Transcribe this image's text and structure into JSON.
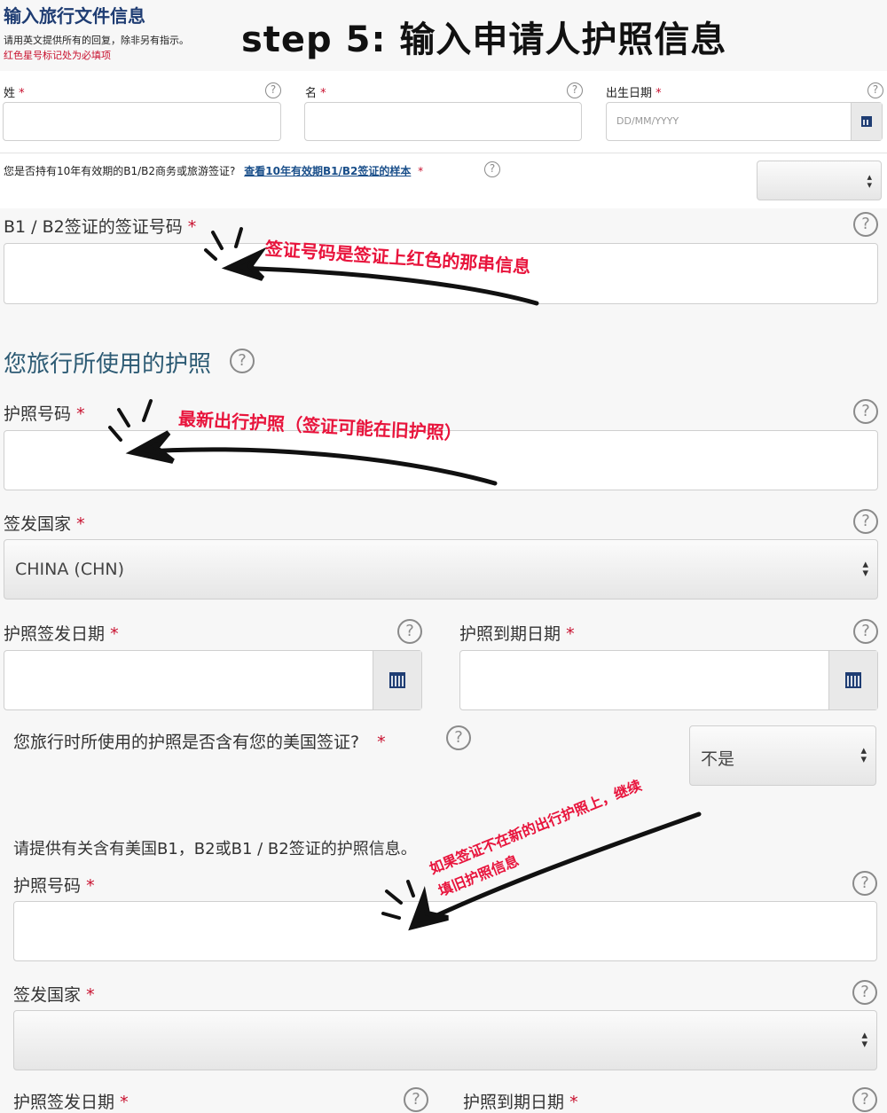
{
  "header": {
    "title": "输入旅行文件信息",
    "subtitle": "请用英文提供所有的回复，除非另有指示。",
    "required_note": "红色星号标记处为必填项",
    "step_title": "step 5: 输入申请人护照信息"
  },
  "applicant": {
    "surname_label": "姓",
    "given_name_label": "名",
    "dob_label": "出生日期",
    "dob_placeholder": "DD/MM/YYYY",
    "visa_question": "您是否持有10年有效期的B1/B2商务或旅游签证?",
    "visa_sample_link": "查看10年有效期B1/B2签证的样本",
    "visa_number_label": "B1 / B2签证的签证号码"
  },
  "passport_section": {
    "title": "您旅行所使用的护照",
    "passport_number_label": "护照号码",
    "issuing_country_label": "签发国家",
    "issuing_country_value": "CHINA (CHN)",
    "issue_date_label": "护照签发日期",
    "expiry_date_label": "护照到期日期",
    "contains_visa_question": "您旅行时所使用的护照是否含有您的美国签证?",
    "contains_visa_value": "不是"
  },
  "old_passport_section": {
    "intro": "请提供有关含有美国B1，B2或B1 / B2签证的护照信息。",
    "passport_number_label": "护照号码",
    "issuing_country_label": "签发国家",
    "issue_date_label": "护照签发日期",
    "expiry_date_label": "护照到期日期"
  },
  "annotations": {
    "visa_number_note": "签证号码是签证上红色的那串信息",
    "passport_note": "最新出行护照（签证可能在旧护照）",
    "old_passport_note_line1": "如果签证不在新的出行护照上，继续",
    "old_passport_note_line2": "填旧护照信息"
  },
  "symbols": {
    "required": "*",
    "help": "?"
  },
  "icons": [
    "help-circle-icon",
    "calendar-icon",
    "select-arrows-icon",
    "hand-drawn-arrow-icon"
  ],
  "colors": {
    "title": "#1f3d73",
    "section_title": "#2d5b74",
    "required": "#c8102e",
    "annotation": "#e8143c",
    "link": "#1a4f8a"
  }
}
